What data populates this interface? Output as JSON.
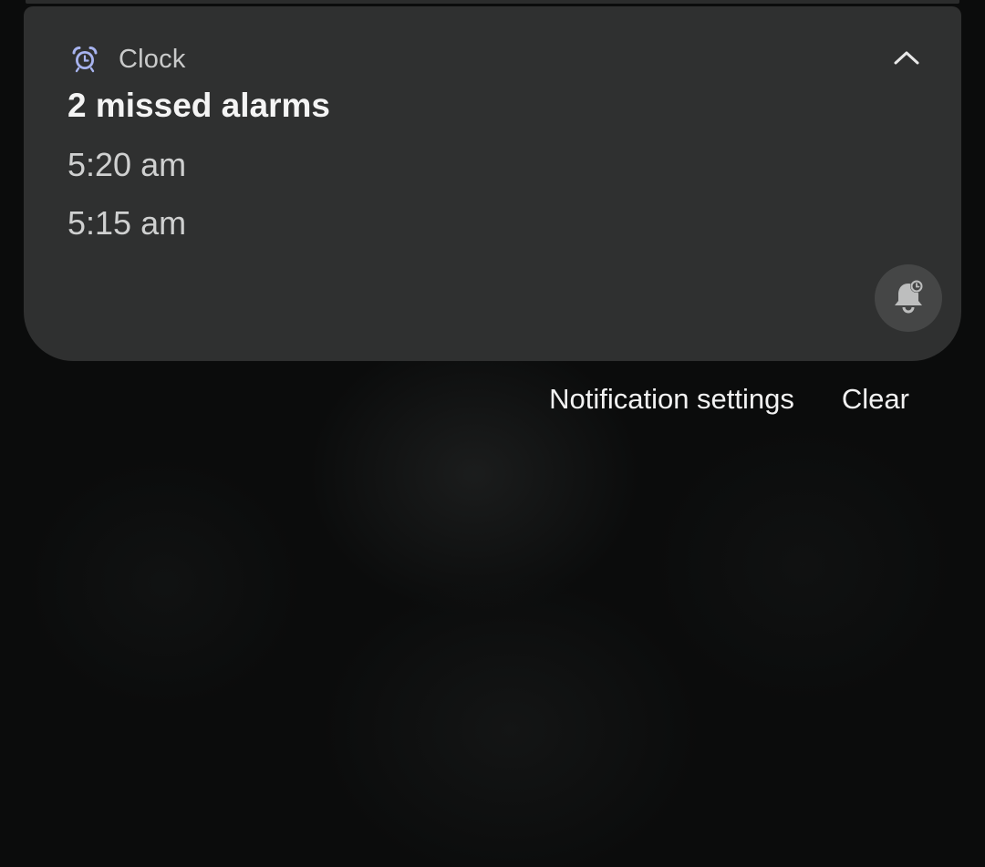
{
  "notification": {
    "app_name": "Clock",
    "app_icon": "alarm-clock-icon",
    "title": "2 missed alarms",
    "alarms": [
      "5:20 am",
      "5:15 am"
    ],
    "collapse_icon": "chevron-up-icon",
    "action_icon": "bell-alarm-icon"
  },
  "actions": {
    "settings_label": "Notification settings",
    "clear_label": "Clear"
  },
  "colors": {
    "card": "#2f3030",
    "icon_accent": "#a8b4f0",
    "background": "#0b0c0c"
  }
}
